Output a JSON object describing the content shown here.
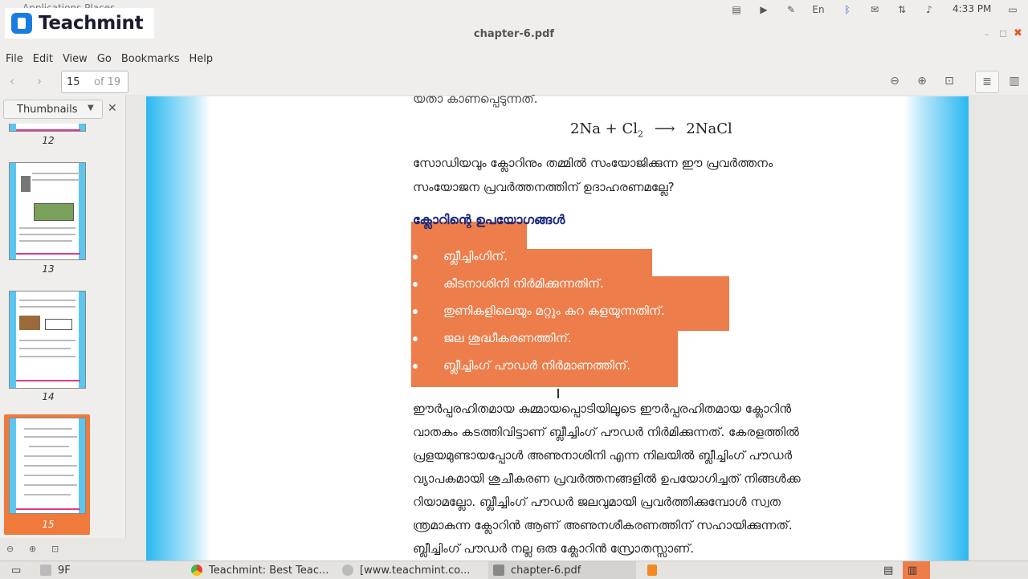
{
  "system": {
    "apps_label": "Applications  Places",
    "clock": "4:33 PM",
    "tray": [
      "notes-icon",
      "video-icon",
      "pen-icon",
      "En",
      "bluetooth-icon",
      "mail-icon",
      "network-icon",
      "volume-icon",
      "display-icon"
    ]
  },
  "logo": {
    "text": "Teachmint"
  },
  "window": {
    "title": "chapter-6.pdf"
  },
  "menu": [
    "File",
    "Edit",
    "View",
    "Go",
    "Bookmarks",
    "Help"
  ],
  "toolbar": {
    "page": "15",
    "of": "of 19"
  },
  "sidebar": {
    "view": "Thumbnails",
    "thumbnails": [
      {
        "page": "12"
      },
      {
        "page": "13"
      },
      {
        "page": "14"
      },
      {
        "page": "15",
        "active": true
      }
    ]
  },
  "document": {
    "line_top": "യതാ കാണപ്പെടുന്നത്.",
    "equation": {
      "lhs": "2Na + Cl",
      "sub": "2",
      "arrow": "⟶",
      "rhs": "2NaCl"
    },
    "para1": [
      "സോഡിയവും ക്ലോറിനും തമ്മിൽ സംയോജിക്കുന്ന ഈ പ്രവർത്തനം",
      "സംയോജന പ്രവർത്തനത്തിന് ഉദാഹരണമല്ലേ?"
    ],
    "heading": "ക്ലോറിന്റെ ഉപയോഗങ്ങൾ",
    "bullets": [
      "ബ്ലീച്ചിംഗിന്.",
      "കീടനാശിനി നിർമിക്കുന്നതിന്.",
      "തുണികളിലെയും മറ്റും കറ കളയുന്നതിന്.",
      "ജല ശുദ്ധീകരണത്തിന്.",
      "ബ്ലീച്ചിംഗ് പൗഡർ നിർമാണത്തിന്."
    ],
    "para2": [
      "ഈർപ്പരഹിതമായ കുമ്മായപ്പൊടിയിലൂടെ ഈർപ്പരഹിതമായ ക്ലോറിൻ",
      "വാതകം കടത്തിവിട്ടാണ് ബ്ലീച്ചിംഗ് പൗഡർ നിർമിക്കുന്നത്. കേരളത്തിൽ",
      "പ്രളയമുണ്ടായപ്പോൾ അണുനാശിനി എന്ന നിലയിൽ ബ്ലീച്ചിംഗ് പൗഡർ",
      "വ്യാപകമായി ശുചീകരണ പ്രവർത്തനങ്ങളിൽ ഉപയോഗിച്ചത് നിങ്ങൾക്ക",
      "റിയാമല്ലോ. ബ്ലീച്ചിംഗ് പൗഡർ ജലവുമായി പ്രവർത്തിക്കുമ്പോൾ സ്വത",
      "ന്ത്രമാകുന്ന ക്ലോറിൻ ആണ് അണുനശീകരണത്തിന് സഹായിക്കുന്നത്.",
      "ബ്ലീച്ചിംഗ് പൗഡർ നല്ല ഒരു ക്ലോറിൻ സ്രോതസ്സാണ്."
    ]
  },
  "taskbar": [
    {
      "label": "9F"
    },
    {
      "label": "Teachmint: Best Teac..."
    },
    {
      "label": "[www.teachmint.co..."
    },
    {
      "label": "chapter-6.pdf"
    }
  ],
  "colors": {
    "highlight": "#ed7d4a",
    "accent_cyan": "#29b8f0",
    "heading": "#1b2a7a",
    "active_thumb": "#f07a3c"
  }
}
